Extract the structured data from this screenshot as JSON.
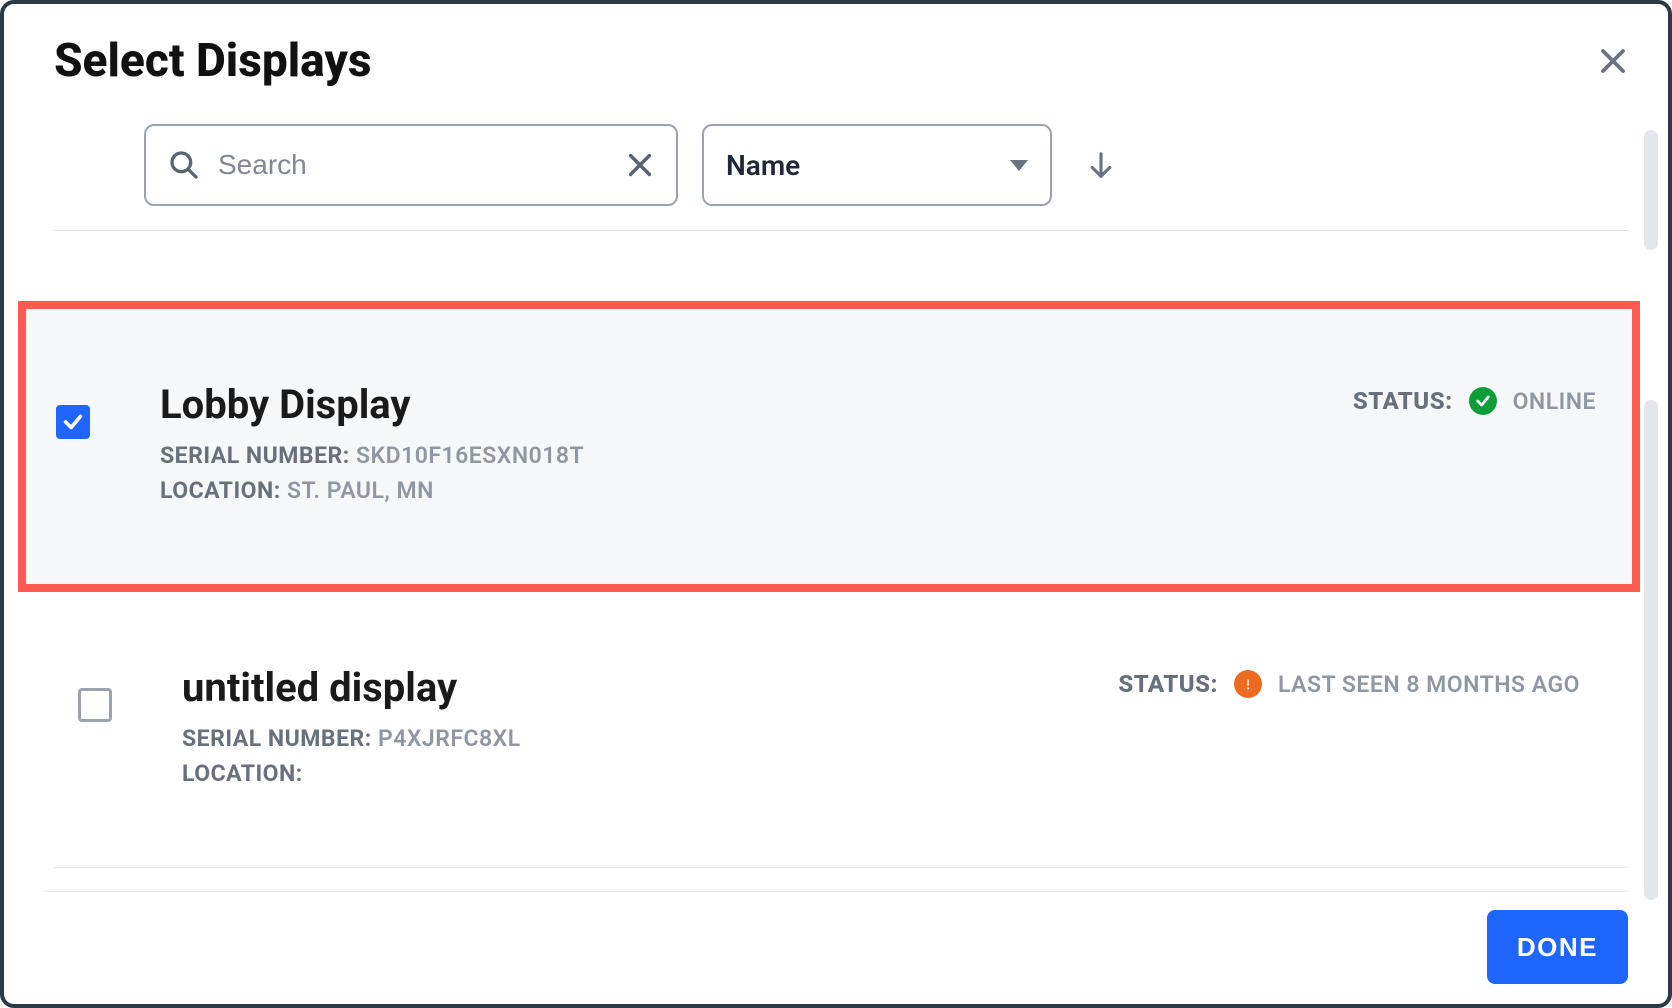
{
  "header": {
    "title": "Select Displays"
  },
  "toolbar": {
    "search_placeholder": "Search",
    "sort_label": "Name"
  },
  "labels": {
    "serial": "SERIAL NUMBER:",
    "location": "LOCATION:",
    "status": "STATUS:"
  },
  "rows": [
    {
      "checked": true,
      "name": "Lobby Display",
      "serial": "SKD10F16ESXN018T",
      "location": "ST. PAUL, MN",
      "status_kind": "online",
      "status_text": "ONLINE"
    },
    {
      "checked": false,
      "name": "untitled display",
      "serial": "P4XJRFC8XL",
      "location": "",
      "status_kind": "offline",
      "status_text": "LAST SEEN 8 MONTHS AGO"
    }
  ],
  "footer": {
    "done_label": "DONE"
  }
}
